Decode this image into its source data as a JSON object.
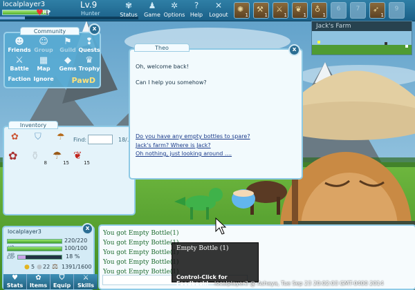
{
  "player": {
    "name": "localplayer3",
    "hp_tag": "HP",
    "level": "Lv.9",
    "class_name": "Hunter",
    "hp_fraction": 0.96,
    "xp_fraction": 0.18
  },
  "nav": [
    {
      "label": "Status",
      "icon": "paw-icon"
    },
    {
      "label": "Game",
      "icon": "person-icon"
    },
    {
      "label": "Options",
      "icon": "gear-icon"
    },
    {
      "label": "Help",
      "icon": "help-icon"
    },
    {
      "label": "Logout",
      "icon": "close-icon"
    }
  ],
  "hotbar": [
    {
      "type": "item",
      "icon": "creature-icon",
      "count": "1"
    },
    {
      "type": "item",
      "icon": "tool-icon",
      "count": "1"
    },
    {
      "type": "item",
      "icon": "sword-icon",
      "count": "1"
    },
    {
      "type": "item",
      "icon": "plant-icon",
      "count": "1"
    },
    {
      "type": "item",
      "icon": "amulet-icon",
      "count": "1"
    },
    {
      "type": "empty",
      "number": "6"
    },
    {
      "type": "empty",
      "number": "7"
    },
    {
      "type": "item",
      "icon": "bow-icon",
      "count": "1"
    },
    {
      "type": "empty",
      "number": "9"
    }
  ],
  "minimap": {
    "title": "Jack's Farm"
  },
  "community": {
    "tab": "Community",
    "close": "x",
    "items": [
      {
        "label": "Friends",
        "icon": "friends-icon",
        "enabled": true
      },
      {
        "label": "Group",
        "icon": "group-icon",
        "enabled": false
      },
      {
        "label": "Guild",
        "icon": "guild-icon",
        "enabled": false
      },
      {
        "label": "Quests",
        "icon": "quests-icon",
        "enabled": true
      },
      {
        "label": "Battle",
        "icon": "battle-icon",
        "enabled": true
      },
      {
        "label": "Map",
        "icon": "map-icon",
        "enabled": true
      },
      {
        "label": "Gems",
        "icon": "gems-icon",
        "enabled": true
      },
      {
        "label": "Trophy",
        "icon": "trophy-icon",
        "enabled": true
      },
      {
        "label": "Faction",
        "icon": "faction-icon",
        "enabled": true
      },
      {
        "label": "Ignore",
        "icon": "ignore-icon",
        "enabled": true
      }
    ],
    "logo": "PawD"
  },
  "inventory": {
    "tab": "Inventory",
    "find_label": "Find:",
    "find_value": "",
    "page_indicator": "18/...",
    "items": [
      {
        "icon": "meat-icon",
        "count": ""
      },
      {
        "icon": "empty-bottle-icon",
        "count": "8"
      },
      {
        "icon": "mushroom-icon",
        "count": "15"
      },
      {
        "icon": "red-leaf-icon",
        "count": "15"
      }
    ]
  },
  "chat": {
    "tab": "Theo",
    "close": "x",
    "lines": [
      "Oh, welcome back!",
      "Can I help you somehow?"
    ],
    "options": [
      "Do you have any empty bottles to spare?",
      "Jack's farm? Where is Jack?",
      "Oh nothing, just looking around ...."
    ]
  },
  "stats_panel": {
    "name": "localplayer3",
    "close": "x",
    "hp": "220/220",
    "mp": "100/100",
    "exp": "18 %",
    "gold": "5",
    "silver": "22",
    "weight": "1391/1600",
    "labels": {
      "hp": "HP",
      "mp": "MP",
      "exp": "EXP"
    },
    "tabs": [
      "Stats",
      "Items",
      "Equip",
      "Skills"
    ]
  },
  "log": {
    "lines": [
      "You got Empty Bottle(1)",
      "You got Empty Bottle(1)",
      "You got Empty Bottle(1)",
      "You got Empty Bottle(1)",
      "You got Empty Bottle(1)"
    ]
  },
  "tooltip": {
    "title": "Empty Bottle",
    "qty": "(1)",
    "footer": "Control-Click for Feedback!"
  },
  "status_line": "localplayer3 @ Ashaya, Tue Sep 23 20:02:03 GMT-0400 2014"
}
